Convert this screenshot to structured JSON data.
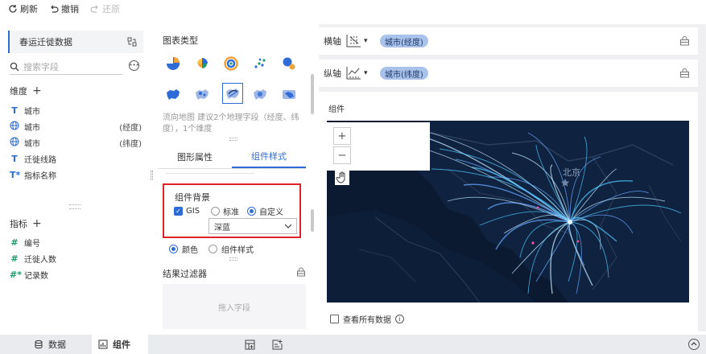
{
  "toolbar": {
    "refresh": "刷新",
    "undo": "撤销",
    "redo": "还原"
  },
  "left": {
    "dataset": "春运迁徙数据",
    "search_placeholder": "搜索字段",
    "dimensions_title": "维度",
    "dimensions": [
      {
        "icon": "T",
        "name": "城市",
        "suffix": ""
      },
      {
        "icon": "globe",
        "name": "城市",
        "suffix": "(经度)"
      },
      {
        "icon": "globe",
        "name": "城市",
        "suffix": "(纬度)"
      },
      {
        "icon": "T",
        "name": "迁徙线路",
        "suffix": ""
      },
      {
        "icon": "T*",
        "name": "指标名称",
        "suffix": ""
      }
    ],
    "measures_title": "指标",
    "measures": [
      {
        "icon": "#",
        "name": "编号"
      },
      {
        "icon": "#",
        "name": "迁徙人数"
      },
      {
        "icon": "#*",
        "name": "记录数"
      }
    ]
  },
  "middle": {
    "chart_type_title": "图表类型",
    "description": "流向地图 建议2个地理字段（经度、纬度），1个维度",
    "tabs": [
      {
        "label": "图形属性",
        "active": false
      },
      {
        "label": "组件样式",
        "active": true
      }
    ],
    "background": {
      "title": "组件背景",
      "gis_label": "GIS",
      "gis_checked": true,
      "options": [
        {
          "label": "标准",
          "selected": false
        },
        {
          "label": "自定义",
          "selected": true
        }
      ],
      "select_value": "深蓝"
    },
    "mode_options": [
      {
        "label": "颜色",
        "selected": true
      },
      {
        "label": "组件样式",
        "selected": false
      }
    ],
    "filter_title": "结果过滤器",
    "drop_hint": "拖入字段"
  },
  "right": {
    "x_axis_label": "横轴",
    "x_axis_field": "城市(经度)",
    "y_axis_label": "纵轴",
    "y_axis_field": "城市(纬度)",
    "component_title": "组件",
    "map_city": "北京",
    "zoom_in": "+",
    "zoom_out": "−",
    "view_all": "查看所有数据"
  },
  "bottom": {
    "data_tab": "数据",
    "component_tab": "组件"
  },
  "colors": {
    "accent": "#2f6bd6",
    "highlight_box": "#e0232b",
    "map_bg": "#0b1a30",
    "flow_line": "#4fc3f7"
  }
}
